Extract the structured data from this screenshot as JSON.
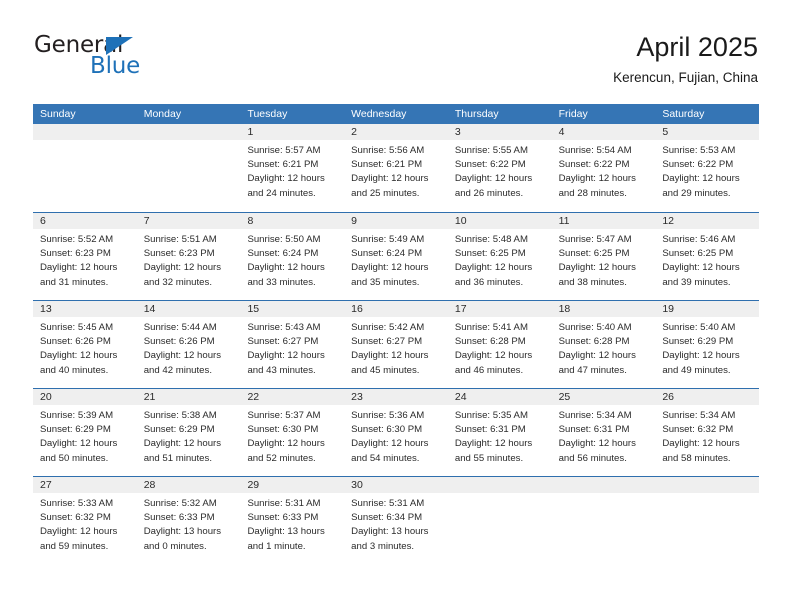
{
  "brand": {
    "name_top": "General",
    "name_bottom": "Blue",
    "triangle_color": "#1e71b8",
    "text_color": "#231f20"
  },
  "header": {
    "title": "April 2025",
    "subtitle": "Kerencun, Fujian, China"
  },
  "theme": {
    "header_bar_color": "#3575b5",
    "day_strip_color": "#efefef",
    "row_divider_color": "#2f6fae",
    "text_color": "#2b2b2b"
  },
  "weekdays": [
    "Sunday",
    "Monday",
    "Tuesday",
    "Wednesday",
    "Thursday",
    "Friday",
    "Saturday"
  ],
  "weeks": [
    [
      {
        "day": "",
        "sunrise": "",
        "sunset": "",
        "daylight": ""
      },
      {
        "day": "",
        "sunrise": "",
        "sunset": "",
        "daylight": ""
      },
      {
        "day": "1",
        "sunrise": "Sunrise: 5:57 AM",
        "sunset": "Sunset: 6:21 PM",
        "daylight": "Daylight: 12 hours and 24 minutes."
      },
      {
        "day": "2",
        "sunrise": "Sunrise: 5:56 AM",
        "sunset": "Sunset: 6:21 PM",
        "daylight": "Daylight: 12 hours and 25 minutes."
      },
      {
        "day": "3",
        "sunrise": "Sunrise: 5:55 AM",
        "sunset": "Sunset: 6:22 PM",
        "daylight": "Daylight: 12 hours and 26 minutes."
      },
      {
        "day": "4",
        "sunrise": "Sunrise: 5:54 AM",
        "sunset": "Sunset: 6:22 PM",
        "daylight": "Daylight: 12 hours and 28 minutes."
      },
      {
        "day": "5",
        "sunrise": "Sunrise: 5:53 AM",
        "sunset": "Sunset: 6:22 PM",
        "daylight": "Daylight: 12 hours and 29 minutes."
      }
    ],
    [
      {
        "day": "6",
        "sunrise": "Sunrise: 5:52 AM",
        "sunset": "Sunset: 6:23 PM",
        "daylight": "Daylight: 12 hours and 31 minutes."
      },
      {
        "day": "7",
        "sunrise": "Sunrise: 5:51 AM",
        "sunset": "Sunset: 6:23 PM",
        "daylight": "Daylight: 12 hours and 32 minutes."
      },
      {
        "day": "8",
        "sunrise": "Sunrise: 5:50 AM",
        "sunset": "Sunset: 6:24 PM",
        "daylight": "Daylight: 12 hours and 33 minutes."
      },
      {
        "day": "9",
        "sunrise": "Sunrise: 5:49 AM",
        "sunset": "Sunset: 6:24 PM",
        "daylight": "Daylight: 12 hours and 35 minutes."
      },
      {
        "day": "10",
        "sunrise": "Sunrise: 5:48 AM",
        "sunset": "Sunset: 6:25 PM",
        "daylight": "Daylight: 12 hours and 36 minutes."
      },
      {
        "day": "11",
        "sunrise": "Sunrise: 5:47 AM",
        "sunset": "Sunset: 6:25 PM",
        "daylight": "Daylight: 12 hours and 38 minutes."
      },
      {
        "day": "12",
        "sunrise": "Sunrise: 5:46 AM",
        "sunset": "Sunset: 6:25 PM",
        "daylight": "Daylight: 12 hours and 39 minutes."
      }
    ],
    [
      {
        "day": "13",
        "sunrise": "Sunrise: 5:45 AM",
        "sunset": "Sunset: 6:26 PM",
        "daylight": "Daylight: 12 hours and 40 minutes."
      },
      {
        "day": "14",
        "sunrise": "Sunrise: 5:44 AM",
        "sunset": "Sunset: 6:26 PM",
        "daylight": "Daylight: 12 hours and 42 minutes."
      },
      {
        "day": "15",
        "sunrise": "Sunrise: 5:43 AM",
        "sunset": "Sunset: 6:27 PM",
        "daylight": "Daylight: 12 hours and 43 minutes."
      },
      {
        "day": "16",
        "sunrise": "Sunrise: 5:42 AM",
        "sunset": "Sunset: 6:27 PM",
        "daylight": "Daylight: 12 hours and 45 minutes."
      },
      {
        "day": "17",
        "sunrise": "Sunrise: 5:41 AM",
        "sunset": "Sunset: 6:28 PM",
        "daylight": "Daylight: 12 hours and 46 minutes."
      },
      {
        "day": "18",
        "sunrise": "Sunrise: 5:40 AM",
        "sunset": "Sunset: 6:28 PM",
        "daylight": "Daylight: 12 hours and 47 minutes."
      },
      {
        "day": "19",
        "sunrise": "Sunrise: 5:40 AM",
        "sunset": "Sunset: 6:29 PM",
        "daylight": "Daylight: 12 hours and 49 minutes."
      }
    ],
    [
      {
        "day": "20",
        "sunrise": "Sunrise: 5:39 AM",
        "sunset": "Sunset: 6:29 PM",
        "daylight": "Daylight: 12 hours and 50 minutes."
      },
      {
        "day": "21",
        "sunrise": "Sunrise: 5:38 AM",
        "sunset": "Sunset: 6:29 PM",
        "daylight": "Daylight: 12 hours and 51 minutes."
      },
      {
        "day": "22",
        "sunrise": "Sunrise: 5:37 AM",
        "sunset": "Sunset: 6:30 PM",
        "daylight": "Daylight: 12 hours and 52 minutes."
      },
      {
        "day": "23",
        "sunrise": "Sunrise: 5:36 AM",
        "sunset": "Sunset: 6:30 PM",
        "daylight": "Daylight: 12 hours and 54 minutes."
      },
      {
        "day": "24",
        "sunrise": "Sunrise: 5:35 AM",
        "sunset": "Sunset: 6:31 PM",
        "daylight": "Daylight: 12 hours and 55 minutes."
      },
      {
        "day": "25",
        "sunrise": "Sunrise: 5:34 AM",
        "sunset": "Sunset: 6:31 PM",
        "daylight": "Daylight: 12 hours and 56 minutes."
      },
      {
        "day": "26",
        "sunrise": "Sunrise: 5:34 AM",
        "sunset": "Sunset: 6:32 PM",
        "daylight": "Daylight: 12 hours and 58 minutes."
      }
    ],
    [
      {
        "day": "27",
        "sunrise": "Sunrise: 5:33 AM",
        "sunset": "Sunset: 6:32 PM",
        "daylight": "Daylight: 12 hours and 59 minutes."
      },
      {
        "day": "28",
        "sunrise": "Sunrise: 5:32 AM",
        "sunset": "Sunset: 6:33 PM",
        "daylight": "Daylight: 13 hours and 0 minutes."
      },
      {
        "day": "29",
        "sunrise": "Sunrise: 5:31 AM",
        "sunset": "Sunset: 6:33 PM",
        "daylight": "Daylight: 13 hours and 1 minute."
      },
      {
        "day": "30",
        "sunrise": "Sunrise: 5:31 AM",
        "sunset": "Sunset: 6:34 PM",
        "daylight": "Daylight: 13 hours and 3 minutes."
      },
      {
        "day": "",
        "sunrise": "",
        "sunset": "",
        "daylight": ""
      },
      {
        "day": "",
        "sunrise": "",
        "sunset": "",
        "daylight": ""
      },
      {
        "day": "",
        "sunrise": "",
        "sunset": "",
        "daylight": ""
      }
    ]
  ]
}
